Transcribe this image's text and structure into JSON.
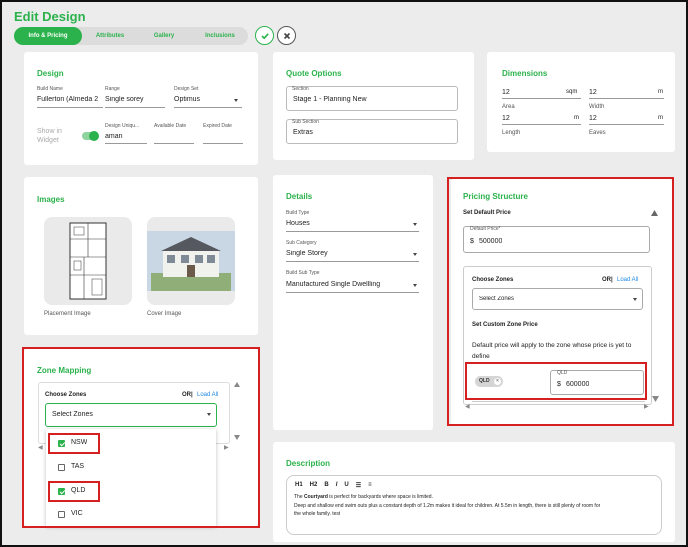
{
  "page": {
    "title": "Edit Design",
    "tabs": [
      "Info & Pricing",
      "Attributes",
      "Gallery",
      "Inclusions"
    ]
  },
  "design": {
    "title": "Design",
    "build_name_label": "Build Name",
    "build_name_value": "Fullerton (Almeda 2",
    "range_label": "Range",
    "range_value": "Single sorey",
    "design_set_label": "Design Set",
    "design_set_value": "Optimus",
    "show_in_widget_label": "Show in Widget",
    "design_unique_label": "Design Uniqu...",
    "design_unique_value": "aman",
    "available_date_label": "Available Date",
    "expired_date_label": "Expired Date"
  },
  "quote": {
    "title": "Quote Options",
    "section_label": "Section",
    "section_value": "Stage 1 - Planning New",
    "sub_section_label": "Sub Section",
    "sub_section_value": "Extras"
  },
  "dimensions": {
    "title": "Dimensions",
    "area_value": "12",
    "area_unit": "sqm",
    "area_label": "Area",
    "width_value": "12",
    "width_unit": "m",
    "width_label": "Width",
    "length_value": "12",
    "length_unit": "m",
    "length_label": "Length",
    "eaves_value": "12",
    "eaves_unit": "m",
    "eaves_label": "Eaves"
  },
  "images": {
    "title": "Images",
    "placement_label": "Placement Image",
    "cover_label": "Cover Image"
  },
  "details": {
    "title": "Details",
    "build_type_label": "Build Type",
    "build_type_value": "Houses",
    "sub_category_label": "Sub Category",
    "sub_category_value": "Single Storey",
    "build_sub_type_label": "Build Sub Type",
    "build_sub_type_value": "Manufactured Single Dwellling"
  },
  "pricing": {
    "title": "Pricing Structure",
    "set_default_label": "Set Default Price",
    "default_price_label": "Default Price*",
    "currency": "$",
    "default_price_value": "500000",
    "choose_zones_label": "Choose Zones",
    "or_label": "OR|",
    "load_all_label": "Load All",
    "select_zones_placeholder": "Select Zones",
    "custom_zone_label": "Set Custom Zone Price",
    "default_note": "Default price will apply to the zone whose price is yet to define",
    "chip_label": "QLD",
    "zone_field_label": "QLD",
    "zone_price_value": "600000"
  },
  "zone_mapping": {
    "title": "Zone Mapping",
    "choose_zones_label": "Choose Zones",
    "or_label": "OR|",
    "load_all_label": "Load All",
    "select_zones_placeholder": "Select Zones",
    "options": [
      {
        "label": "NSW",
        "checked": true
      },
      {
        "label": "TAS",
        "checked": false
      },
      {
        "label": "QLD",
        "checked": true
      },
      {
        "label": "VIC",
        "checked": false
      }
    ]
  },
  "description": {
    "title": "Description",
    "toolbar": [
      "H1",
      "H2",
      "B",
      "I",
      "U"
    ],
    "text_prefix": "The ",
    "text_bold": "Courtyard",
    "text_line1_rest": " is perfect for backyards where space is limited.",
    "text_line2": "Deep and shallow end swim outs plus a constant depth of 1.2m makes it ideal for children. At 5.5m in length, there is still plenty of room for",
    "text_line3": "the whole family. test"
  },
  "colors": {
    "accent": "#2bb24c",
    "highlight": "#d62020",
    "link": "#1e88e5"
  }
}
